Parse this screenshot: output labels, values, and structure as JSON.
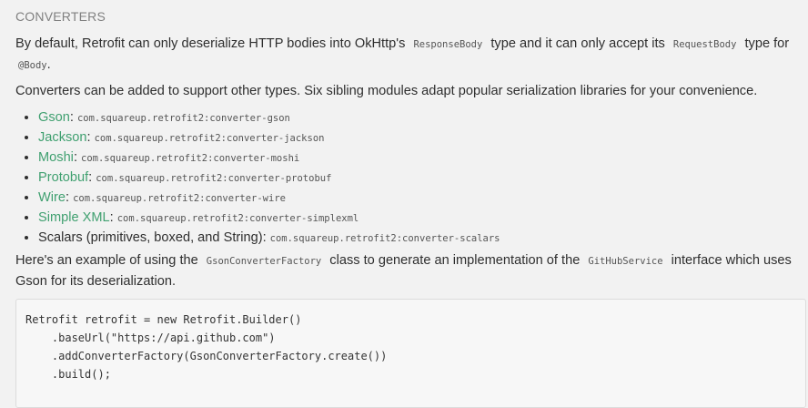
{
  "section": {
    "title": "CONVERTERS"
  },
  "intro": {
    "text_before": "By default, Retrofit can only deserialize HTTP bodies into OkHttp's",
    "code_response_body": "ResponseBody",
    "text_middle": "type and it can only accept its",
    "code_request_body": "RequestBody",
    "text_after": "type for",
    "code_body_annotation": "@Body",
    "text_end": "."
  },
  "converters_intro": "Converters can be added to support other types. Six sibling modules adapt popular serialization libraries for your convenience.",
  "converters": [
    {
      "name": "Gson",
      "sep": ":",
      "artifact": "com.squareup.retrofit2:converter-gson",
      "link": true
    },
    {
      "name": "Jackson",
      "sep": ":",
      "artifact": "com.squareup.retrofit2:converter-jackson",
      "link": true
    },
    {
      "name": "Moshi",
      "sep": ":",
      "artifact": "com.squareup.retrofit2:converter-moshi",
      "link": true
    },
    {
      "name": "Protobuf",
      "sep": ":",
      "artifact": "com.squareup.retrofit2:converter-protobuf",
      "link": true
    },
    {
      "name": "Wire",
      "sep": ":",
      "artifact": "com.squareup.retrofit2:converter-wire",
      "link": true
    },
    {
      "name": "Simple XML",
      "sep": ":",
      "artifact": "com.squareup.retrofit2:converter-simplexml",
      "link": true
    },
    {
      "name": "Scalars (primitives, boxed, and String)",
      "sep": ":",
      "artifact": "com.squareup.retrofit2:converter-scalars",
      "link": false
    }
  ],
  "example": {
    "text_before": "Here's an example of using the",
    "code_factory": "GsonConverterFactory",
    "text_middle": "class to generate an implementation of the",
    "code_service": "GitHubService",
    "text_after": "interface which uses Gson for its deserialization."
  },
  "code_block": {
    "lines": [
      "Retrofit retrofit = new Retrofit.Builder()",
      "    .baseUrl(\"https://api.github.com\")",
      "    .addConverterFactory(GsonConverterFactory.create())",
      "    .build();"
    ]
  }
}
